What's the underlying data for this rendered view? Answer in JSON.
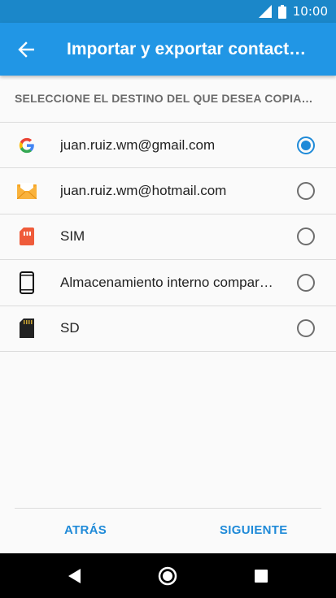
{
  "status_bar": {
    "time": "10:00"
  },
  "app_bar": {
    "title": "Importar y exportar contact…",
    "back_icon": "arrow-left-icon"
  },
  "section_header": "SELECCIONE EL DESTINO DEL QUE DESEA COPIA…",
  "accounts": [
    {
      "label": "juan.ruiz.wm@gmail.com",
      "icon": "google-icon",
      "selected": true
    },
    {
      "label": "juan.ruiz.wm@hotmail.com",
      "icon": "mail-icon",
      "selected": false
    },
    {
      "label": "SIM",
      "icon": "sim-card-icon",
      "selected": false
    },
    {
      "label": "Almacenamiento interno compar…",
      "icon": "phone-icon",
      "selected": false
    },
    {
      "label": "SD",
      "icon": "sd-card-icon",
      "selected": false
    }
  ],
  "footer": {
    "back_label": "ATRÁS",
    "next_label": "SIGUIENTE"
  },
  "colors": {
    "status_bar": "#1b87c9",
    "app_bar": "#2196e5",
    "accent": "#1f8ad8"
  }
}
